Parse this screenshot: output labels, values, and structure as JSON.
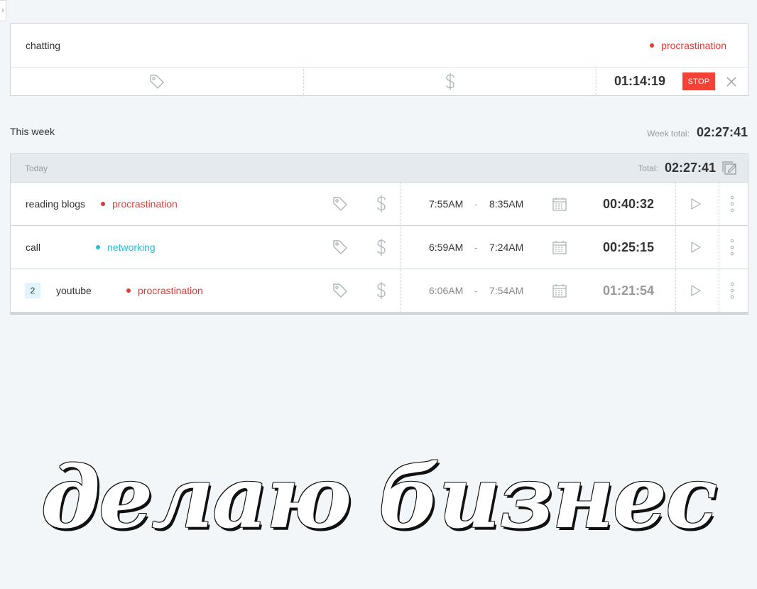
{
  "timer": {
    "description": "chatting",
    "project": {
      "name": "procrastination",
      "color": "#e53935"
    },
    "tag_icon": "tag-icon",
    "billable_icon": "dollar-icon",
    "elapsed": "01:14:19",
    "stop_label": "STOP",
    "discard_icon": "close-icon"
  },
  "week": {
    "label": "This week",
    "total_label": "Week total:",
    "total": "02:27:41"
  },
  "day": {
    "name": "Today",
    "total_label": "Total:",
    "total": "02:27:41",
    "bulk_edit_icon": "bulk-edit-icon"
  },
  "entries": [
    {
      "description": "reading blogs",
      "project": {
        "name": "procrastination",
        "color": "#e53935"
      },
      "start": "7:55AM",
      "sep": "-",
      "end": "8:35AM",
      "duration": "00:40:32"
    },
    {
      "description": "call",
      "project": {
        "name": "networking",
        "color": "#26bcd2"
      },
      "start": "6:59AM",
      "sep": "-",
      "end": "7:24AM",
      "duration": "00:25:15"
    },
    {
      "group_count": "2",
      "description": "youtube",
      "project": {
        "name": "procrastination",
        "color": "#e53935"
      },
      "start": "6:06AM",
      "sep": "-",
      "end": "7:54AM",
      "duration": "01:21:54"
    }
  ],
  "colors": {
    "accent_red": "#f44336",
    "background": "#f2f6f8",
    "border": "#cfd6db"
  },
  "watermark": {
    "text": "делаю бизнес"
  }
}
